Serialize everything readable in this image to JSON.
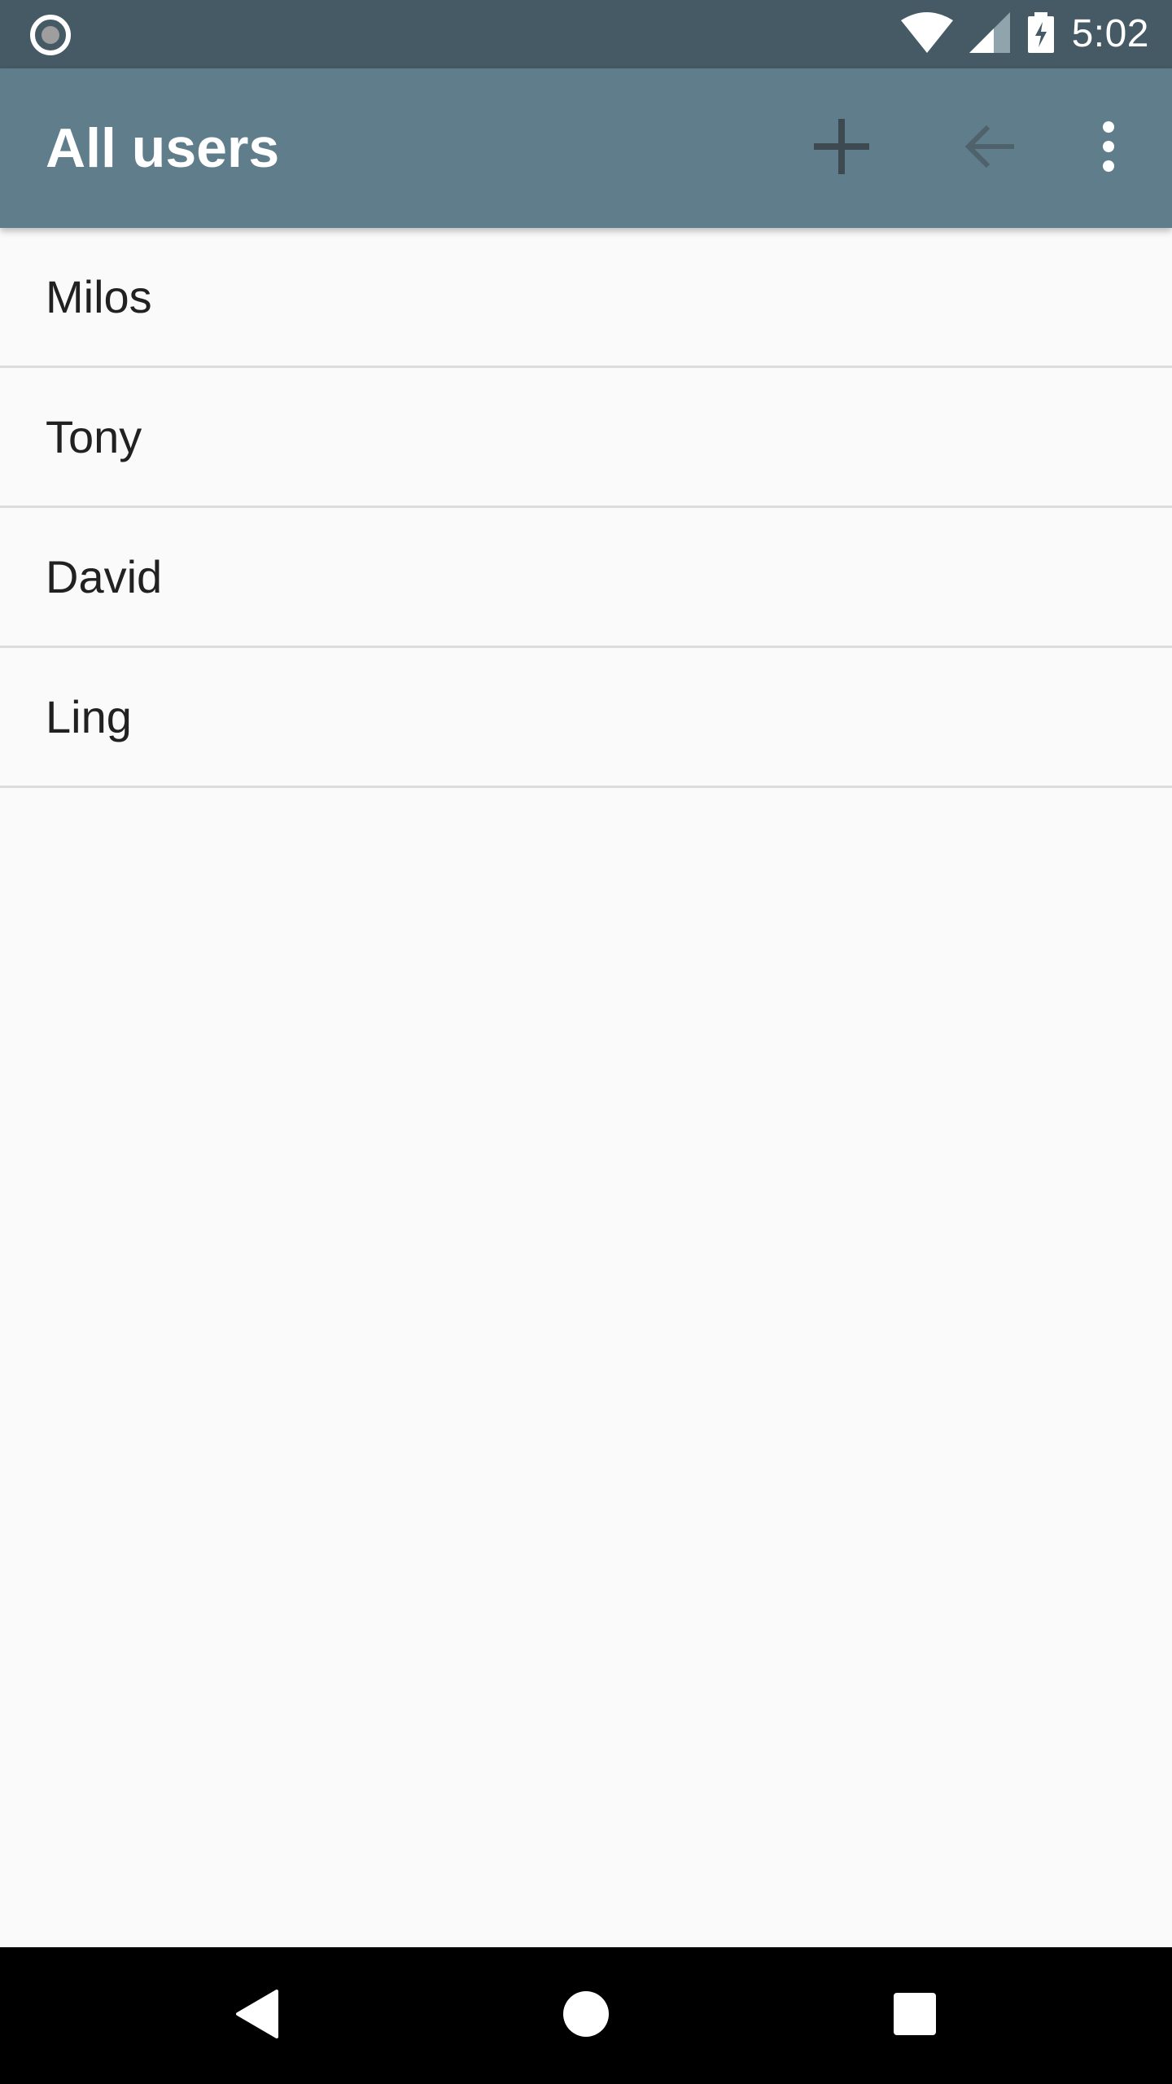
{
  "status_bar": {
    "time": "5:02",
    "icons": [
      "radio-indicator-icon",
      "wifi-icon",
      "cell-signal-icon",
      "battery-charging-icon"
    ],
    "background": "#455a64"
  },
  "app_bar": {
    "title": "All users",
    "background": "#607d8b",
    "actions": [
      "add-icon",
      "arrow-back-icon",
      "more-vert-icon"
    ]
  },
  "users": [
    {
      "name": "Milos"
    },
    {
      "name": "Tony"
    },
    {
      "name": "David"
    },
    {
      "name": "Ling"
    }
  ],
  "nav_bar": {
    "buttons": [
      "back-triangle-icon",
      "home-circle-icon",
      "recents-square-icon"
    ]
  }
}
